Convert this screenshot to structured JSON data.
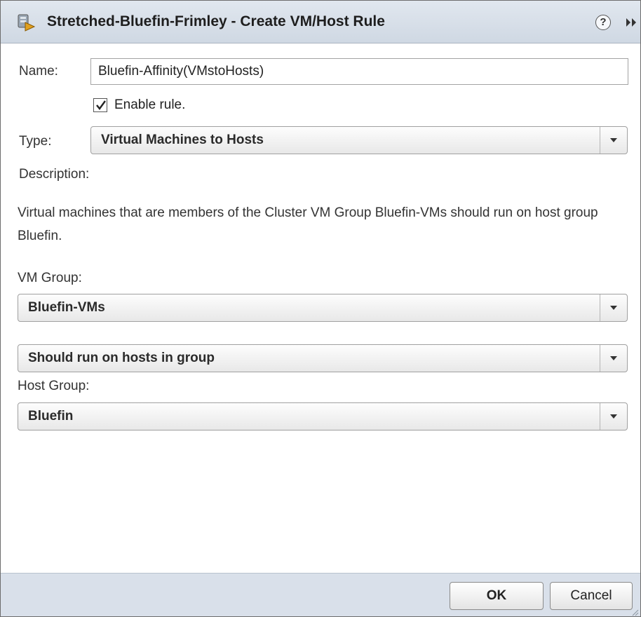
{
  "dialog": {
    "title": "Stretched-Bluefin-Frimley - Create VM/Host Rule",
    "title_icon": "cluster-rule-icon",
    "help_icon": "help-icon",
    "help_glyph": "?",
    "expand_icon": "expand-icon"
  },
  "form": {
    "name_label": "Name:",
    "name_value": "Bluefin-Affinity(VMstoHosts)",
    "enable_label": "Enable rule.",
    "enable_checked": true,
    "type_label": "Type:",
    "type_value": "Virtual Machines to Hosts",
    "description_label": "Description:",
    "description_text": "Virtual machines that are members of the Cluster VM Group Bluefin-VMs should run on host group Bluefin.",
    "vm_group_label": "VM Group:",
    "vm_group_value": "Bluefin-VMs",
    "relation_value": "Should run on hosts in group",
    "host_group_label": "Host Group:",
    "host_group_value": "Bluefin"
  },
  "footer": {
    "ok_label": "OK",
    "cancel_label": "Cancel"
  },
  "colors": {
    "titlebar": "#d6dee8",
    "footer": "#d9e0ea",
    "accent": "#e0a020"
  }
}
